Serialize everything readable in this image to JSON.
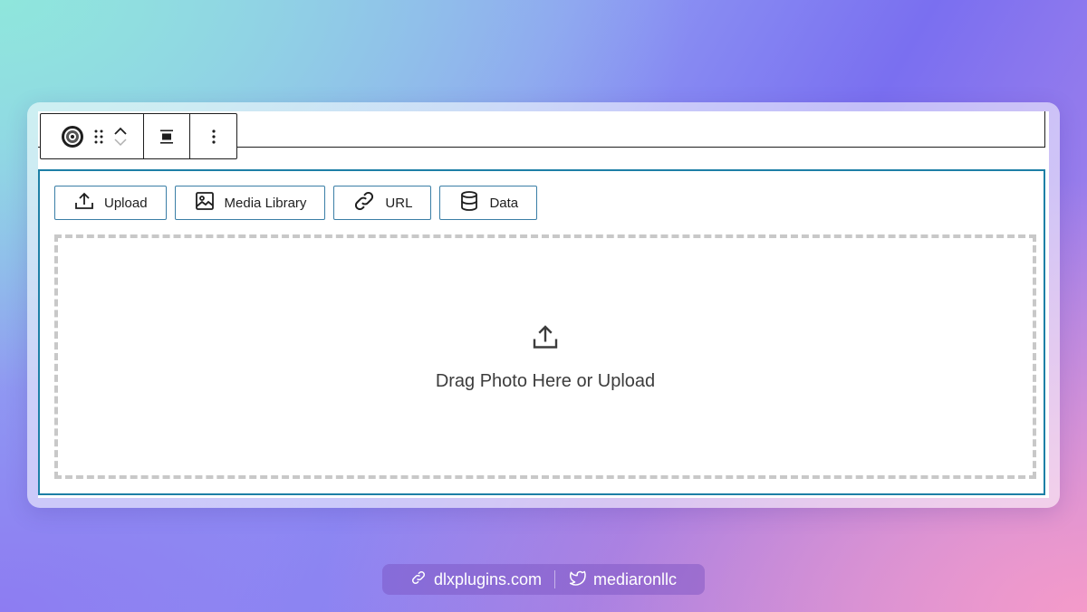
{
  "toolbar": {
    "block_icon": "block-type-icon",
    "drag_icon": "drag-handle-icon",
    "move_up_icon": "chevron-up-icon",
    "move_down_icon": "chevron-down-icon",
    "align_icon": "align-center-icon",
    "options_icon": "more-vertical-icon"
  },
  "placeholder_buttons": [
    {
      "label": "Upload",
      "icon": "upload-icon"
    },
    {
      "label": "Media Library",
      "icon": "image-icon"
    },
    {
      "label": "URL",
      "icon": "link-icon"
    },
    {
      "label": "Data",
      "icon": "database-icon"
    }
  ],
  "dropzone": {
    "text": "Drag Photo Here or Upload",
    "icon": "upload-icon"
  },
  "footer": {
    "website": "dlxplugins.com",
    "twitter": "mediaronllc"
  },
  "colors": {
    "accent": "#1d7fa6",
    "button_border": "#3a7ea6",
    "dashed_border": "#c8c8c8"
  }
}
